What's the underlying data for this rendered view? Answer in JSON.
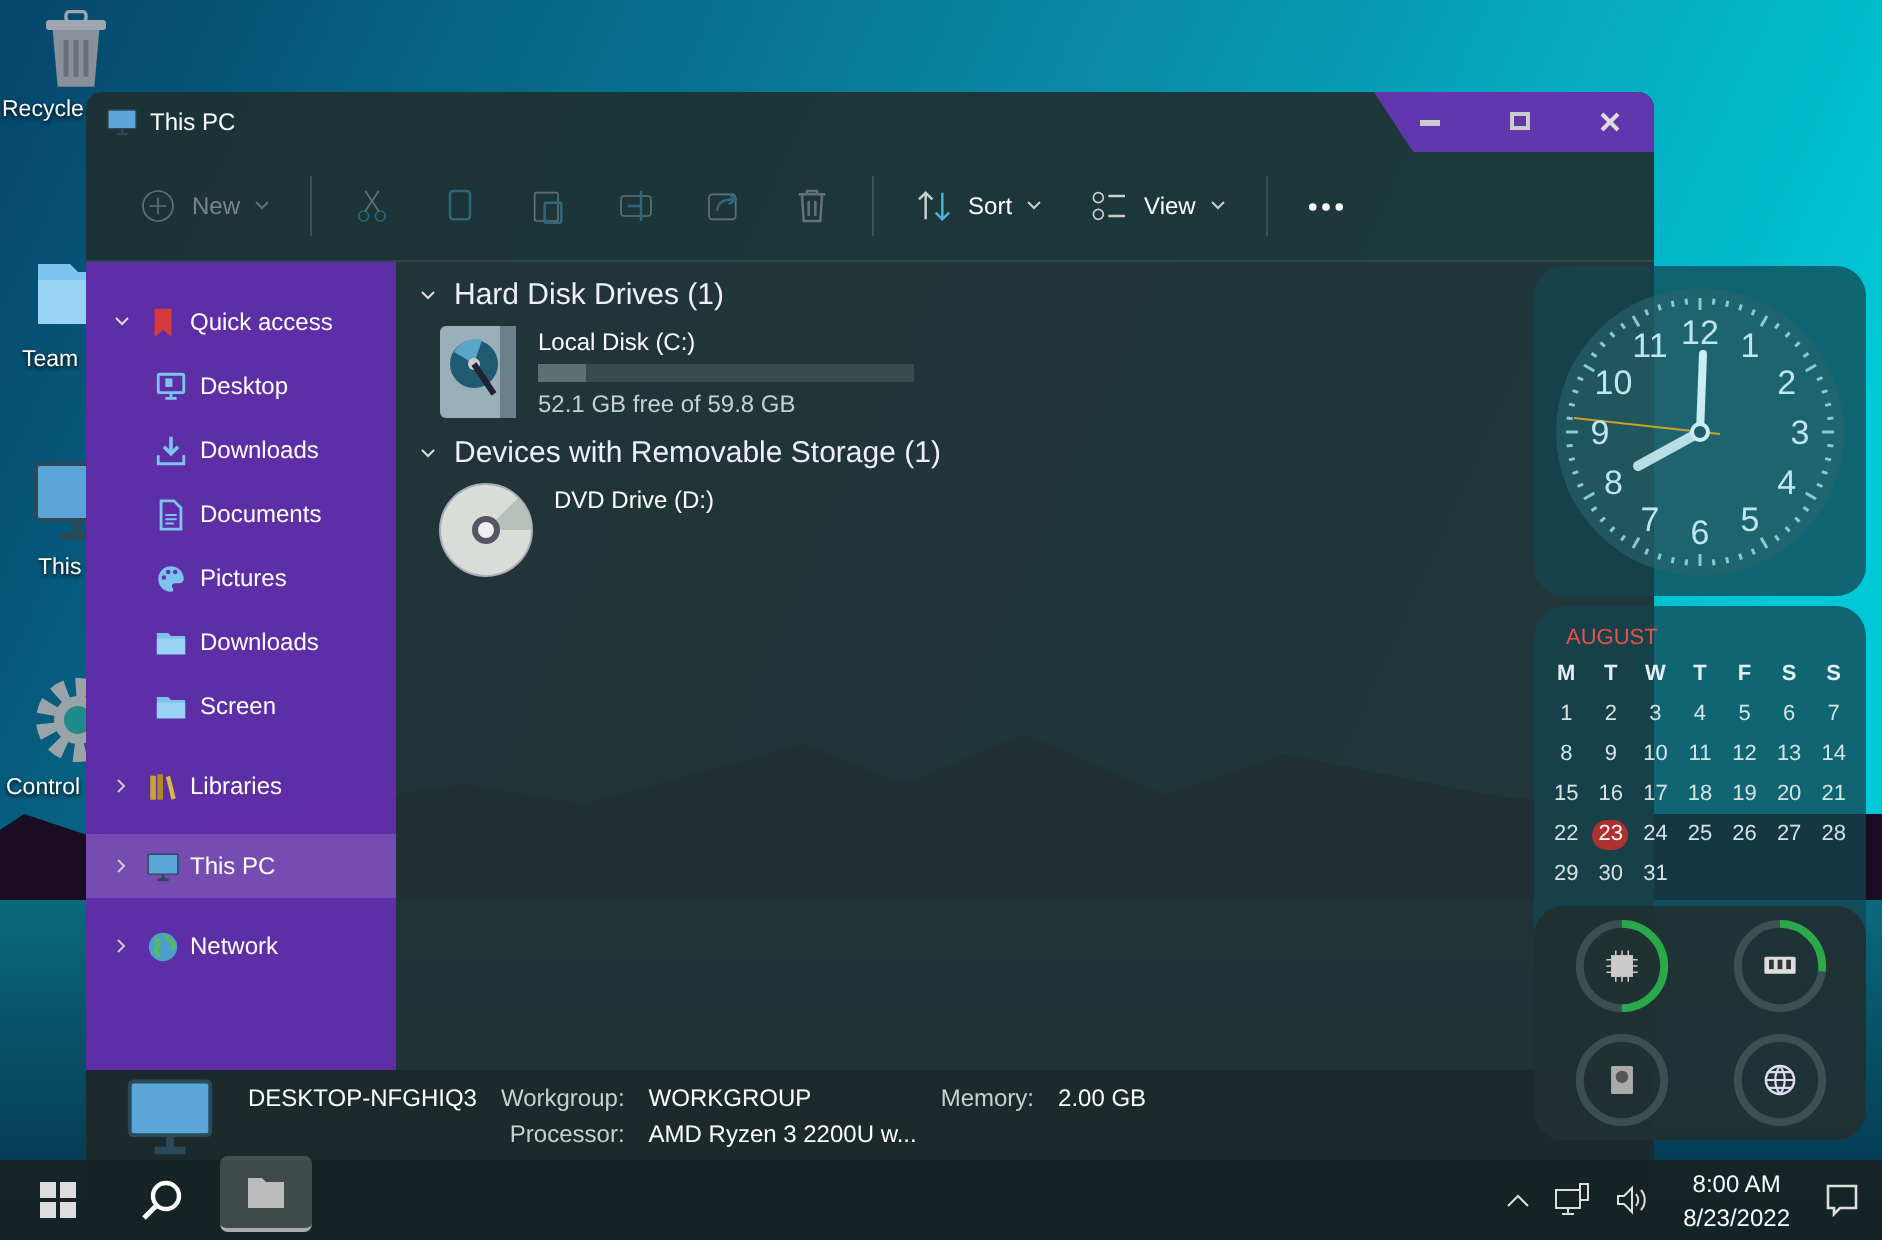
{
  "desktop_icons": [
    {
      "kind": "trash",
      "label": "Recycle"
    },
    {
      "kind": "folder",
      "label": "Team"
    },
    {
      "kind": "monitor",
      "label": "This"
    },
    {
      "kind": "gear",
      "label": "Control"
    }
  ],
  "widgets": {
    "clock": {
      "numerals": [
        "12",
        "11",
        "1",
        "10",
        "2",
        "9",
        "3",
        "8",
        "4",
        "7",
        "5",
        "6"
      ]
    },
    "calendar": {
      "month": "AUGUST",
      "weekdays": [
        "M",
        "T",
        "W",
        "T",
        "F",
        "S",
        "S"
      ],
      "days": [
        {
          "d": "1",
          "today": false
        },
        {
          "d": "2",
          "today": false
        },
        {
          "d": "3",
          "today": false
        },
        {
          "d": "4",
          "today": false
        },
        {
          "d": "5",
          "today": false
        },
        {
          "d": "6",
          "today": false
        },
        {
          "d": "7",
          "today": false
        },
        {
          "d": "8",
          "today": false
        },
        {
          "d": "9",
          "today": false
        },
        {
          "d": "10",
          "today": false
        },
        {
          "d": "11",
          "today": false
        },
        {
          "d": "12",
          "today": false
        },
        {
          "d": "13",
          "today": false
        },
        {
          "d": "14",
          "today": false
        },
        {
          "d": "15",
          "today": false
        },
        {
          "d": "16",
          "today": false
        },
        {
          "d": "17",
          "today": false
        },
        {
          "d": "18",
          "today": false
        },
        {
          "d": "19",
          "today": false
        },
        {
          "d": "20",
          "today": false
        },
        {
          "d": "21",
          "today": false
        },
        {
          "d": "22",
          "today": false
        },
        {
          "d": "23",
          "today": true
        },
        {
          "d": "24",
          "today": false
        },
        {
          "d": "25",
          "today": false
        },
        {
          "d": "26",
          "today": false
        },
        {
          "d": "27",
          "today": false
        },
        {
          "d": "28",
          "today": false
        },
        {
          "d": "29",
          "today": false
        },
        {
          "d": "30",
          "today": false
        },
        {
          "d": "31",
          "today": false
        }
      ]
    },
    "gauges": [
      {
        "kind": "cpu",
        "level": 0.5
      },
      {
        "kind": "ram",
        "level": 0.27
      },
      {
        "kind": "disk"
      },
      {
        "kind": "network"
      }
    ]
  },
  "window": {
    "title": "This PC",
    "toolbar": [
      {
        "kind": "new",
        "label": "New",
        "disabled": true
      },
      {
        "kind": "cut",
        "disabled": true
      },
      {
        "kind": "copy",
        "disabled": true
      },
      {
        "kind": "paste",
        "disabled": true
      },
      {
        "kind": "rename",
        "disabled": true
      },
      {
        "kind": "share",
        "disabled": true
      },
      {
        "kind": "delete",
        "disabled": true
      },
      {
        "kind": "sort",
        "label": "Sort",
        "disabled": false
      },
      {
        "kind": "view",
        "label": "View",
        "disabled": false
      },
      {
        "kind": "more",
        "disabled": false
      }
    ]
  },
  "sidebar": {
    "items": [
      {
        "kind": "bookmark",
        "label": "Quick access",
        "expanded": true,
        "selected": false,
        "children": [
          {
            "kind": "desktop",
            "label": "Desktop",
            "selected": false
          },
          {
            "kind": "download",
            "label": "Downloads",
            "selected": false
          },
          {
            "kind": "document",
            "label": "Documents",
            "selected": false
          },
          {
            "kind": "palette",
            "label": "Pictures",
            "selected": false
          },
          {
            "kind": "folder",
            "label": "Downloads",
            "selected": false
          },
          {
            "kind": "folder",
            "label": "Screen",
            "selected": false
          }
        ]
      },
      {
        "kind": "books",
        "label": "Libraries",
        "expanded": false,
        "selected": false
      },
      {
        "kind": "monitor",
        "label": "This PC",
        "expanded": false,
        "selected": true
      },
      {
        "kind": "globe",
        "label": "Network",
        "expanded": false,
        "selected": false
      }
    ]
  },
  "content": {
    "groups": [
      {
        "title": "Hard Disk Drives (1)",
        "expanded": true,
        "items": [
          {
            "kind": "disk",
            "name": "Local Disk (C:)",
            "level": 0.13,
            "info": "52.1 GB free of 59.8 GB"
          }
        ]
      },
      {
        "title": "Devices with Removable Storage (1)",
        "expanded": true,
        "items": [
          {
            "kind": "dvd",
            "name": "DVD Drive (D:)"
          }
        ]
      }
    ]
  },
  "details": {
    "computer_name": "DESKTOP-NFGHIQ3",
    "fields": [
      {
        "label": "Workgroup:",
        "value": "WORKGROUP"
      },
      {
        "label": "Memory:",
        "value": "2.00 GB"
      },
      {
        "label": "Processor:",
        "value": "AMD Ryzen 3 2200U w..."
      }
    ]
  },
  "taskbar": {
    "buttons": [
      {
        "kind": "start",
        "selected": false
      },
      {
        "kind": "search",
        "selected": false
      },
      {
        "kind": "explorer",
        "selected": true
      }
    ],
    "tray": {
      "time": "8:00 AM",
      "date": "8/23/2022"
    }
  }
}
